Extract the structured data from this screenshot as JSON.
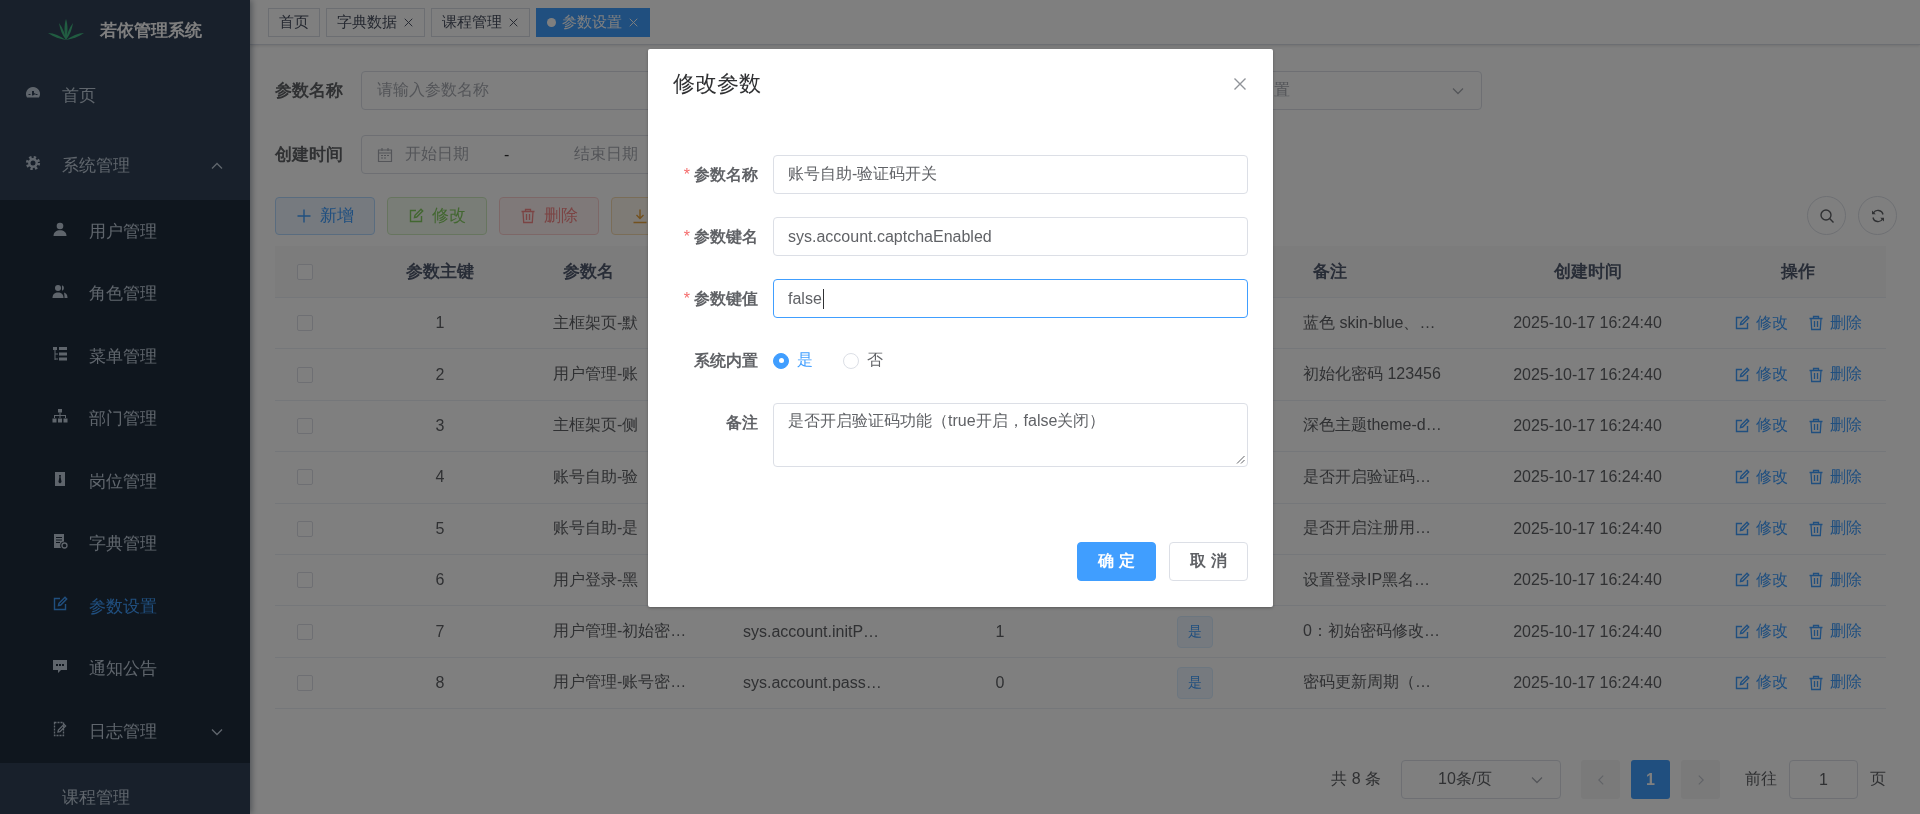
{
  "sidebar": {
    "title": "若依管理系统",
    "items": [
      {
        "label": "首页",
        "kind": "dashboard",
        "selected": false
      },
      {
        "label": "系统管理",
        "kind": "gear",
        "selected": false,
        "expanded": true,
        "children": [
          {
            "label": "用户管理",
            "kind": "user",
            "selected": false
          },
          {
            "label": "角色管理",
            "kind": "users",
            "selected": false
          },
          {
            "label": "菜单管理",
            "kind": "tree",
            "selected": false
          },
          {
            "label": "部门管理",
            "kind": "org",
            "selected": false
          },
          {
            "label": "岗位管理",
            "kind": "post",
            "selected": false
          },
          {
            "label": "字典管理",
            "kind": "dict",
            "selected": false
          },
          {
            "label": "参数设置",
            "kind": "edit",
            "selected": true
          },
          {
            "label": "通知公告",
            "kind": "message",
            "selected": false
          },
          {
            "label": "日志管理",
            "kind": "log",
            "selected": false,
            "expanded": false
          }
        ]
      },
      {
        "label": "课程管理",
        "kind": "none",
        "selected": false
      }
    ]
  },
  "tags": [
    {
      "label": "首页",
      "closable": false,
      "selected": false
    },
    {
      "label": "字典数据",
      "closable": true,
      "selected": false
    },
    {
      "label": "课程管理",
      "closable": true,
      "selected": false
    },
    {
      "label": "参数设置",
      "closable": true,
      "selected": true
    }
  ],
  "search": {
    "rows": [
      [
        {
          "kind": "input",
          "label": "参数名称",
          "placeholder": "请输入参数名称"
        },
        {
          "kind": "select",
          "placeholder": "置"
        }
      ],
      [
        {
          "kind": "daterange",
          "label": "创建时间",
          "start_placeholder": "开始日期",
          "separator": "-",
          "end_placeholder": "结束日期"
        }
      ]
    ]
  },
  "toolbar": {
    "buttons": [
      {
        "kind": "primary",
        "label": "新增",
        "disabled": false
      },
      {
        "kind": "success",
        "label": "修改",
        "disabled": true
      },
      {
        "kind": "danger",
        "label": "删除",
        "disabled": true
      },
      {
        "kind": "warning",
        "disabled": false
      }
    ],
    "tools": [
      {
        "kind": "search"
      },
      {
        "kind": "refresh"
      }
    ]
  },
  "table": {
    "all_selected": false,
    "columns": [
      {
        "kind": "text",
        "label": "参数主键"
      },
      {
        "kind": "left",
        "label": "参数名"
      },
      {
        "kind": "left"
      },
      {
        "kind": "text"
      },
      {
        "kind": "tag"
      },
      {
        "kind": "left",
        "label": "备注"
      },
      {
        "kind": "text",
        "label": "创建时间"
      },
      {
        "kind": "actions",
        "label": "操作"
      }
    ],
    "rows": [
      {
        "selected": false,
        "cells": [
          "1",
          "主框架页-默",
          null,
          null,
          null,
          "蓝色 skin-blue、…",
          "2025-10-17 16:24:40"
        ],
        "actions": [
          "修改",
          "删除"
        ]
      },
      {
        "selected": false,
        "cells": [
          "2",
          "用户管理-账",
          null,
          null,
          null,
          "初始化密码 123456",
          "2025-10-17 16:24:40"
        ],
        "actions": [
          "修改",
          "删除"
        ]
      },
      {
        "selected": false,
        "cells": [
          "3",
          "主框架页-侧",
          null,
          null,
          null,
          "深色主题theme-d…",
          "2025-10-17 16:24:40"
        ],
        "actions": [
          "修改",
          "删除"
        ]
      },
      {
        "selected": false,
        "cells": [
          "4",
          "账号自助-验",
          null,
          null,
          null,
          "是否开启验证码…",
          "2025-10-17 16:24:40"
        ],
        "actions": [
          "修改",
          "删除"
        ]
      },
      {
        "selected": false,
        "cells": [
          "5",
          "账号自助-是",
          null,
          null,
          null,
          "是否开启注册用…",
          "2025-10-17 16:24:40"
        ],
        "actions": [
          "修改",
          "删除"
        ]
      },
      {
        "selected": false,
        "cells": [
          "6",
          "用户登录-黑",
          null,
          null,
          null,
          "设置登录IP黑名…",
          "2025-10-17 16:24:40"
        ],
        "actions": [
          "修改",
          "删除"
        ]
      },
      {
        "selected": false,
        "cells": [
          "7",
          "用户管理-初始密…",
          "sys.account.initP…",
          "1",
          "是",
          "0：初始密码修改…",
          "2025-10-17 16:24:40"
        ],
        "actions": [
          "修改",
          "删除"
        ]
      },
      {
        "selected": false,
        "cells": [
          "8",
          "用户管理-账号密…",
          "sys.account.pass…",
          "0",
          "是",
          "密码更新周期（…",
          "2025-10-17 16:24:40"
        ],
        "actions": [
          "修改",
          "删除"
        ]
      }
    ]
  },
  "pagination": {
    "total": "共 8 条",
    "page_size": "10条/页",
    "pages": [
      {
        "label": "1",
        "selected": true
      }
    ],
    "goto_label": "前往",
    "goto_value": "1",
    "goto_suffix": "页"
  },
  "dialog": {
    "title": "修改参数",
    "fields": [
      {
        "kind": "input",
        "marker": "*",
        "label": "参数名称",
        "value": "账号自助-验证码开关",
        "focused": false
      },
      {
        "kind": "input",
        "marker": "*",
        "label": "参数键名",
        "value": "sys.account.captchaEnabled",
        "focused": false
      },
      {
        "kind": "input",
        "marker": "*",
        "label": "参数键值",
        "value": "false",
        "focused": true
      },
      {
        "kind": "radio",
        "label": "系统内置",
        "options": [
          {
            "label": "是",
            "selected": true
          },
          {
            "label": "否",
            "selected": false
          }
        ]
      },
      {
        "kind": "textarea",
        "label": "备注",
        "value": "是否开启验证码功能（true开启，false关闭）",
        "focused": false
      }
    ],
    "buttons": [
      {
        "kind": "primary",
        "label": "确 定"
      },
      {
        "kind": "default",
        "label": "取 消"
      }
    ]
  }
}
